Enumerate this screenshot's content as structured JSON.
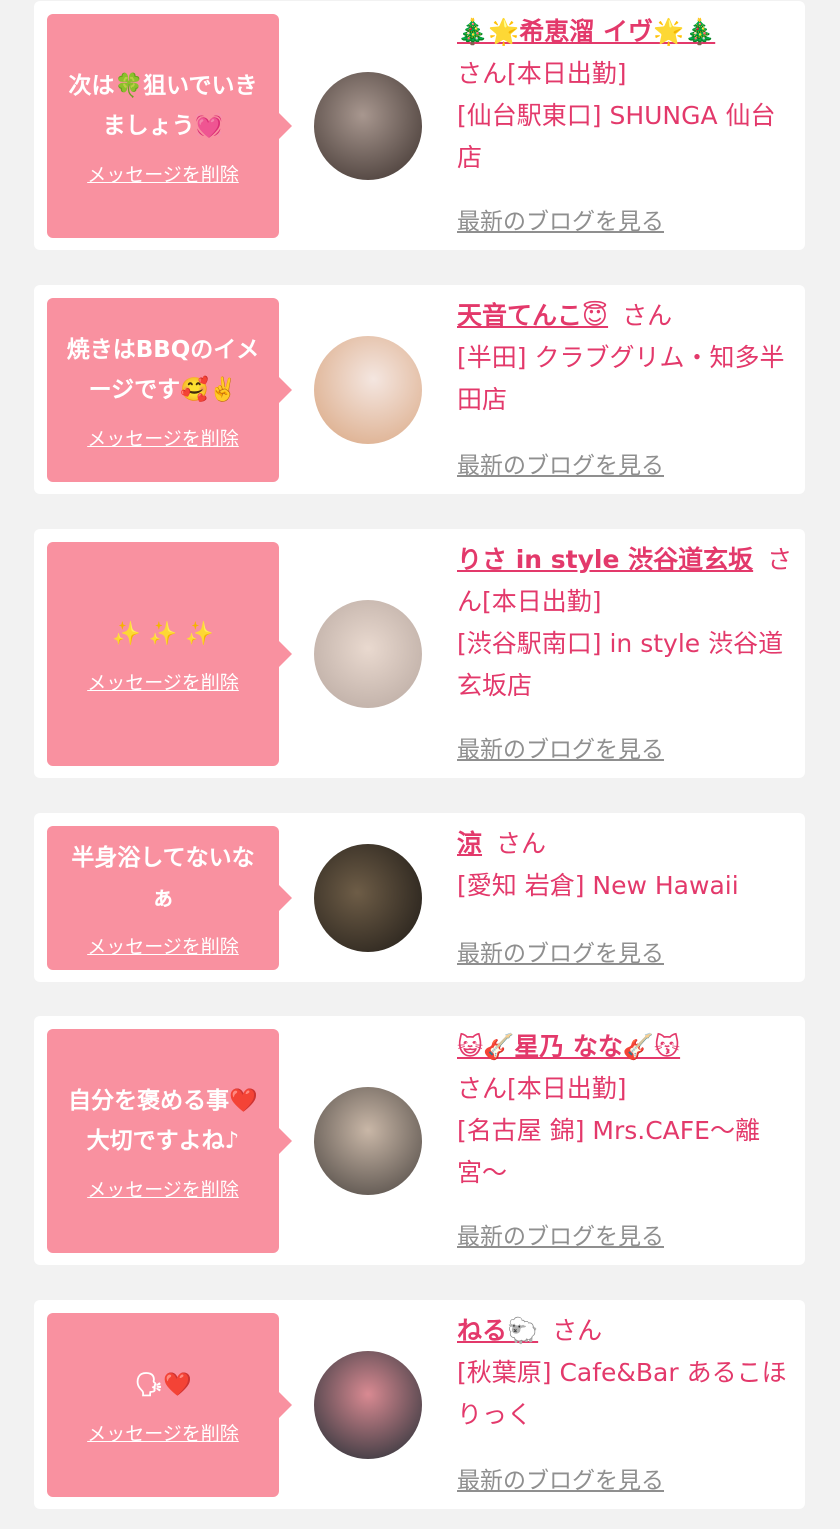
{
  "cards": [
    {
      "message": "次は🍀狙いでいき\nましょう💓",
      "delete_label": "メッセージを削除",
      "name": "🎄🌟希恵溜 イヴ🌟🎄",
      "suffix": "さん[本日出勤]",
      "shop": "[仙台駅東口] SHUNGA 仙台店",
      "blog_label": "最新のブログを見る",
      "avatar_colors": [
        "#a8978f",
        "#3b302c"
      ]
    },
    {
      "message": "焼きはBBQのイメ\nージです🥰✌️",
      "delete_label": "メッセージを削除",
      "name": "天音てんこ😇",
      "suffix": "さん",
      "shop": "[半田] クラブグリム・知多半田店",
      "blog_label": "最新のブログを見る",
      "avatar_colors": [
        "#f4e6e0",
        "#d9a57f"
      ]
    },
    {
      "message": "✨ ✨ ✨",
      "delete_label": "メッセージを削除",
      "name": "りさ in style 渋谷道玄坂",
      "suffix": "さん[本日出勤]",
      "shop": "[渋谷駅南口] in style 渋谷道玄坂店",
      "blog_label": "最新のブログを見る",
      "avatar_colors": [
        "#e9d9cf",
        "#b7a79f"
      ]
    },
    {
      "message": "半身浴してないな\nぁ",
      "delete_label": "メッセージを削除",
      "name": "涼",
      "suffix": "さん",
      "shop": "[愛知 岩倉] New Hawaii",
      "blog_label": "最新のブログを見る",
      "avatar_colors": [
        "#6e5d47",
        "#1e1a16"
      ]
    },
    {
      "message": "自分を褒める事❤️\n大切ですよね♪",
      "delete_label": "メッセージを削除",
      "name": "😺🎸星乃 なな🎸😽",
      "suffix": "さん[本日出勤]",
      "shop": "[名古屋 錦] Mrs.CAFE〜離宮〜",
      "blog_label": "最新のブログを見る",
      "avatar_colors": [
        "#c9b7a7",
        "#4a4440"
      ]
    },
    {
      "message": "🗣❤️",
      "delete_label": "メッセージを削除",
      "name": "ねる🐑",
      "suffix": "さん",
      "shop": "[秋葉原] Cafe&Bar あるこほりっく",
      "blog_label": "最新のブログを見る",
      "avatar_colors": [
        "#d98a92",
        "#1f2c33"
      ]
    }
  ]
}
